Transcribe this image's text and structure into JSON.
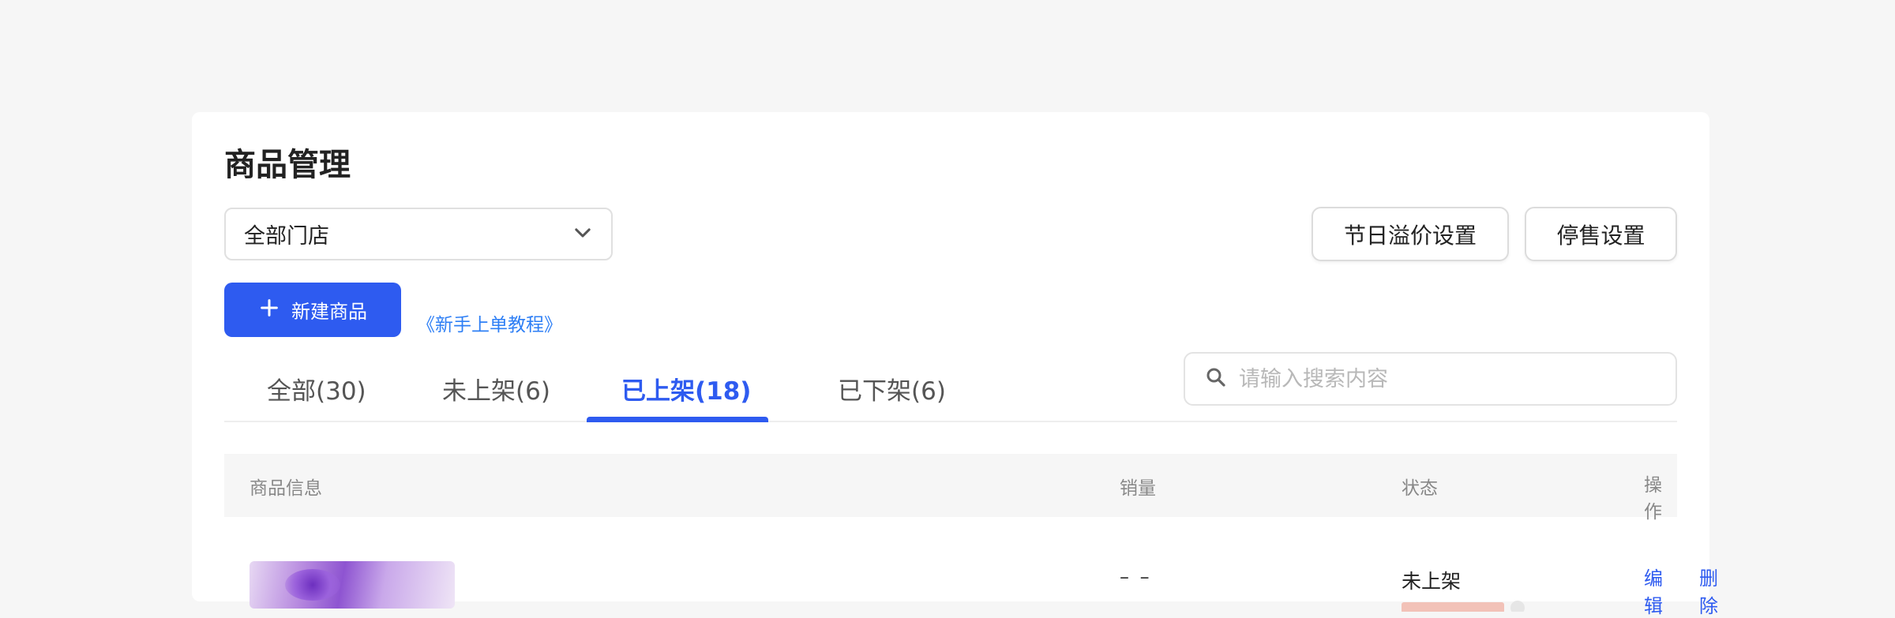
{
  "page": {
    "title": "商品管理"
  },
  "filters": {
    "store_select": {
      "selected": "全部门店"
    },
    "holiday_price_button": "节日溢价设置",
    "stop_sale_button": "停售设置"
  },
  "actions": {
    "new_product_button": "新建商品",
    "tutorial_link": "《新手上单教程》"
  },
  "tabs": [
    {
      "label": "全部(30)",
      "active": false
    },
    {
      "label": "未上架(6)",
      "active": false
    },
    {
      "label": "已上架(18)",
      "active": true
    },
    {
      "label": "已下架(6)",
      "active": false
    }
  ],
  "search": {
    "placeholder": "请输入搜索内容",
    "value": ""
  },
  "table": {
    "columns": [
      "商品信息",
      "销量",
      "状态",
      "操作"
    ],
    "rows": [
      {
        "sales": "– –",
        "status": "未上架",
        "actions": [
          "编辑",
          "删除"
        ]
      }
    ]
  },
  "colors": {
    "accent": "#2e5bf0",
    "link": "#2e7ff5",
    "background": "#f6f6f6",
    "card": "#ffffff"
  },
  "icons": {
    "dropdown": "chevron-down-icon",
    "add": "plus-icon",
    "search": "search-icon"
  }
}
